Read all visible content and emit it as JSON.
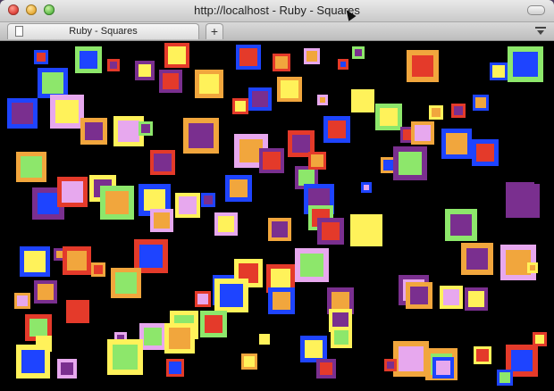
{
  "window": {
    "title": "http://localhost - Ruby - Squares"
  },
  "tabs": [
    {
      "label": "Ruby - Squares"
    }
  ],
  "new_tab_label": "+",
  "palette": {
    "purple": "#7a2f8f",
    "yellow": "#fff25a",
    "orange": "#f1a63d",
    "red": "#e43a2a",
    "green": "#8de76b",
    "blue": "#1e44ff",
    "pink": "#e7a8ee"
  }
}
